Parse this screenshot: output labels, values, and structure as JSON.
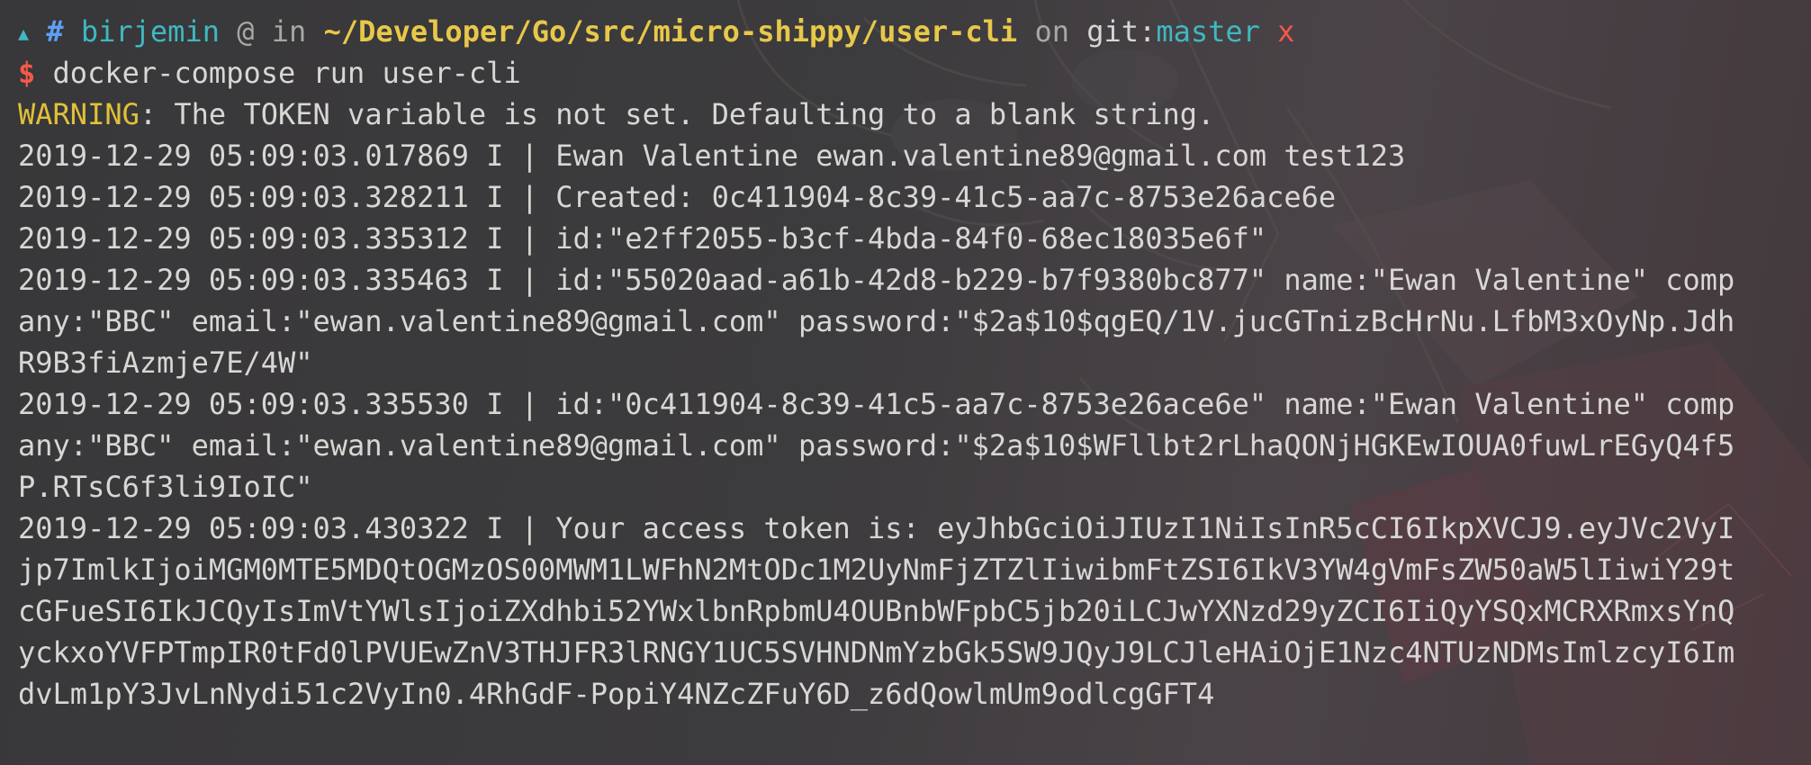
{
  "prompt": {
    "arrow_glyph": "▲",
    "hash": "#",
    "user": "birjemin",
    "at": "@",
    "in": "in",
    "path": "~/Developer/Go/src/micro-shippy/user-cli",
    "on": "on",
    "git_label": "git:",
    "branch": "master",
    "dirty": "x"
  },
  "command": {
    "dollar": "$",
    "text": "docker-compose run user-cli"
  },
  "warning": {
    "label": "WARNING",
    "message": ": The TOKEN variable is not set. Defaulting to a blank string."
  },
  "output_lines": [
    "2019-12-29 05:09:03.017869 I | Ewan Valentine ewan.valentine89@gmail.com test123",
    "2019-12-29 05:09:03.328211 I | Created: 0c411904-8c39-41c5-aa7c-8753e26ace6e",
    "2019-12-29 05:09:03.335312 I | id:\"e2ff2055-b3cf-4bda-84f0-68ec18035e6f\"",
    "2019-12-29 05:09:03.335463 I | id:\"55020aad-a61b-42d8-b229-b7f9380bc877\" name:\"Ewan Valentine\" comp",
    "any:\"BBC\" email:\"ewan.valentine89@gmail.com\" password:\"$2a$10$qgEQ/1V.jucGTnizBcHrNu.LfbM3xOyNp.Jdh",
    "R9B3fiAzmje7E/4W\"",
    "2019-12-29 05:09:03.335530 I | id:\"0c411904-8c39-41c5-aa7c-8753e26ace6e\" name:\"Ewan Valentine\" comp",
    "any:\"BBC\" email:\"ewan.valentine89@gmail.com\" password:\"$2a$10$WFllbt2rLhaQONjHGKEwIOUA0fuwLrEGyQ4f5",
    "P.RTsC6f3li9IoIC\"",
    "2019-12-29 05:09:03.430322 I | Your access token is: eyJhbGciOiJIUzI1NiIsInR5cCI6IkpXVCJ9.eyJVc2VyI",
    "jp7ImlkIjoiMGM0MTE5MDQtOGMzOS00MWM1LWFhN2MtODc1M2UyNmFjZTZlIiwibmFtZSI6IkV3YW4gVmFsZW50aW5lIiwiY29t",
    "cGFueSI6IkJCQyIsImVtYWlsIjoiZXdhbi52YWxlbnRpbmU4OUBnbWFpbC5jb20iLCJwYXNzd29yZCI6IiQyYSQxMCRXRmxsYnQ",
    "yckxoYVFPTmpIR0tFd0lPVUEwZnV3THJFR3lRNGY1UC5SVHNDNmYzbGk5SW9JQyJ9LCJleHAiOjE1Nzc4NTUzNDMsImlzcyI6Im",
    "dvLm1pY3JvLnNydi51c2VyIn0.4RhGdF-PopiY4NZcZFuY6D_z6dQowlmUm9odlcgGFT4"
  ],
  "colors": {
    "background": "#3b3a3c",
    "text": "#d7d7d4",
    "cyan": "#3fb8c2",
    "blue": "#5e9ff0",
    "yellow": "#e8c84a",
    "red": "#f2594a",
    "gray": "#a7a7a4"
  }
}
